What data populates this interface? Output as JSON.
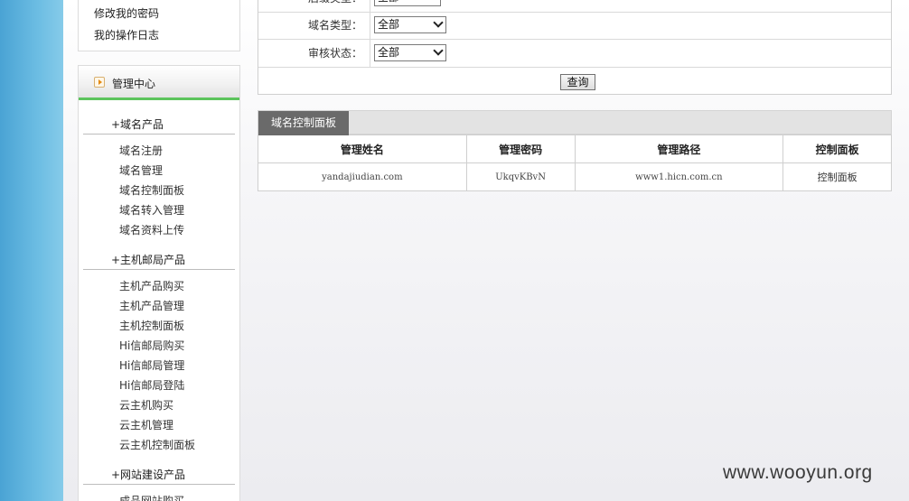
{
  "account_links": [
    "修改我的密码",
    "我的操作日志"
  ],
  "sidebar": {
    "title": "管理中心",
    "groups": [
      {
        "label": "+域名产品",
        "items": [
          "域名注册",
          "域名管理",
          "域名控制面板",
          "域名转入管理",
          "域名资料上传"
        ]
      },
      {
        "label": "+主机邮局产品",
        "items": [
          "主机产品购买",
          "主机产品管理",
          "主机控制面板",
          "Hi信邮局购买",
          "Hi信邮局管理",
          "Hi信邮局登陆",
          "云主机购买",
          "云主机管理",
          "云主机控制面板"
        ]
      },
      {
        "label": "+网站建设产品",
        "items": [
          "成品网站购买"
        ]
      }
    ]
  },
  "filter": {
    "rows": [
      {
        "label": "后缀类型：",
        "value": "全部"
      },
      {
        "label": "域名类型：",
        "value": "全部"
      },
      {
        "label": "审核状态：",
        "value": "全部"
      }
    ],
    "query_button": "查询"
  },
  "panel": {
    "tab_label": "域名控制面板",
    "columns": [
      "管理姓名",
      "管理密码",
      "管理路径",
      "控制面板"
    ],
    "rows": [
      [
        "yandajiudian.com",
        "UkqvKBvN",
        "www1.hicn.com.cn",
        "控制面板"
      ]
    ]
  },
  "watermark": "www.wooyun.org"
}
